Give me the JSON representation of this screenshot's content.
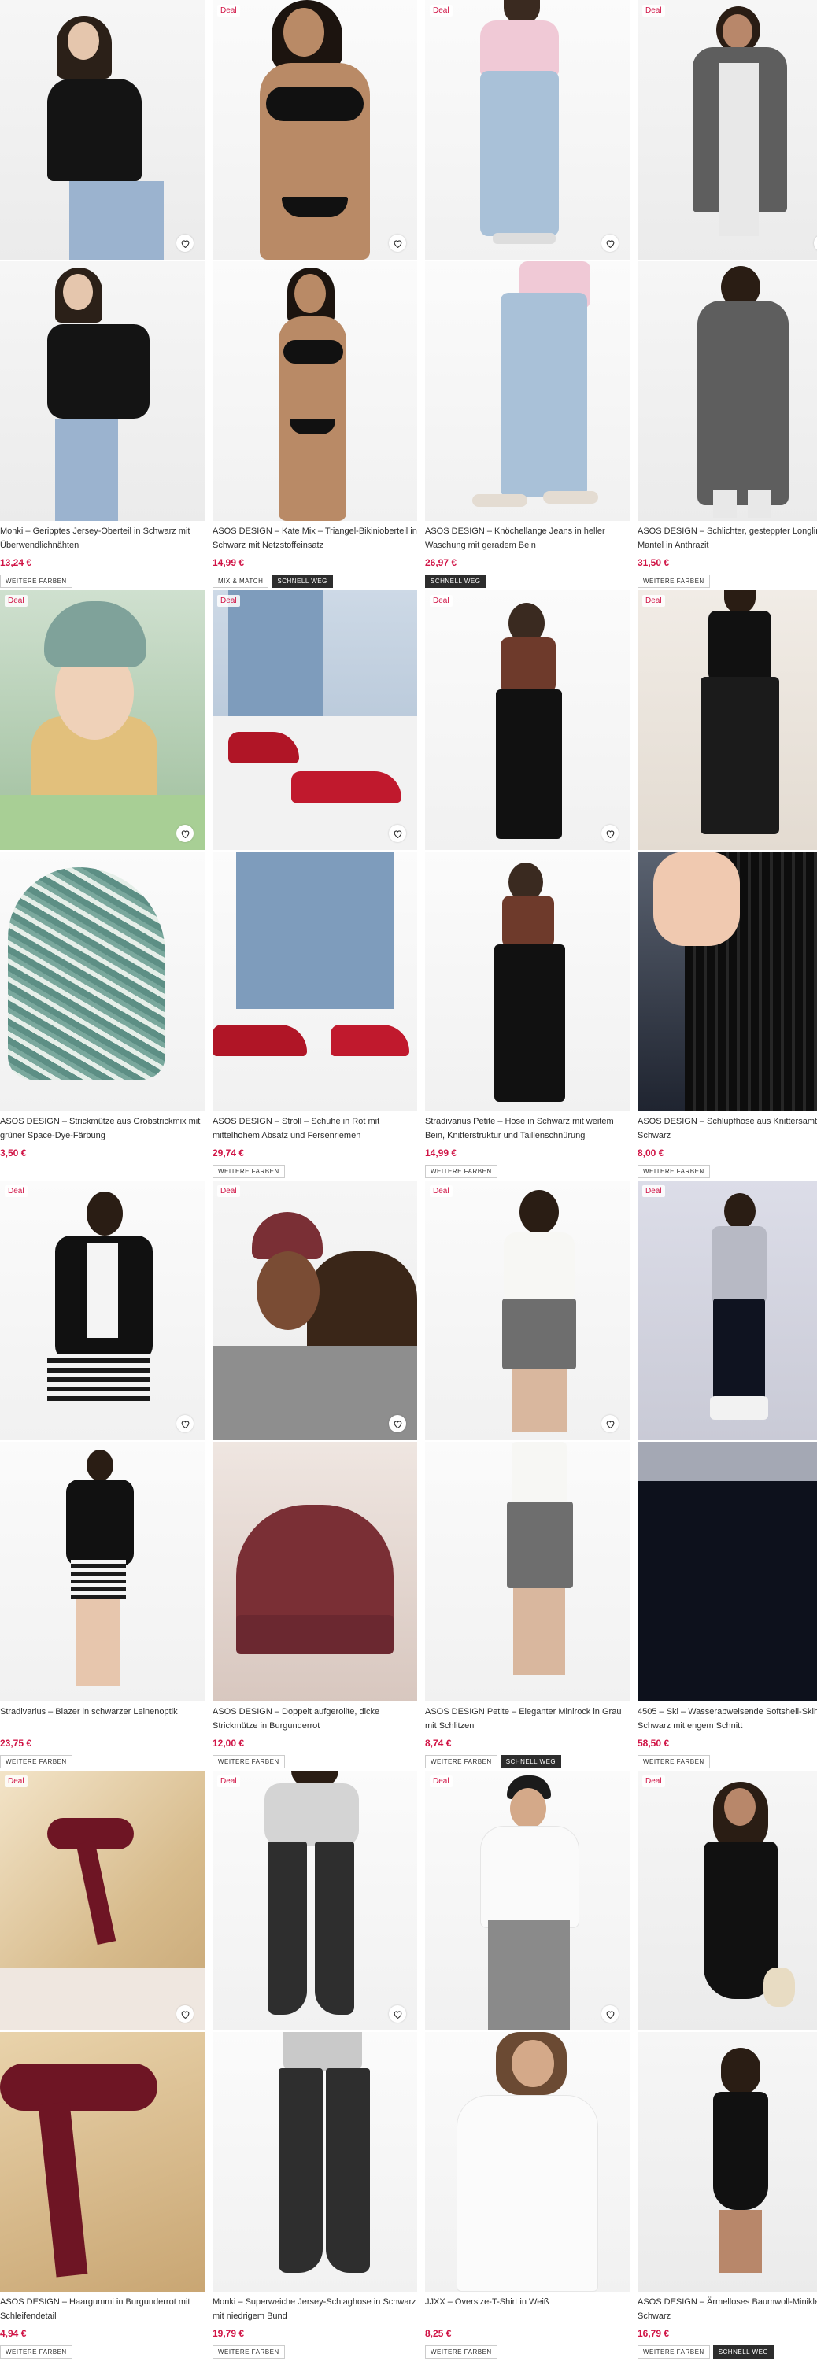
{
  "labels": {
    "deal": "Deal"
  },
  "products": [
    {
      "title": "Monki – Geripptes Jersey-Oberteil in Schwarz mit Überwendlichnähten",
      "price": "13,24 €",
      "deal": false,
      "tags": [
        {
          "label": "WEITERE FARBEN",
          "style": "outline"
        }
      ]
    },
    {
      "title": "ASOS DESIGN – Kate Mix – Triangel-Bikinioberteil in Schwarz mit Netzstoffeinsatz",
      "price": "14,99 €",
      "deal": true,
      "tags": [
        {
          "label": "MIX & MATCH",
          "style": "outline"
        },
        {
          "label": "SCHNELL WEG",
          "style": "dark"
        }
      ]
    },
    {
      "title": "ASOS DESIGN – Knöchellange Jeans in heller Waschung mit geradem Bein",
      "price": "26,97 €",
      "deal": true,
      "tags": [
        {
          "label": "SCHNELL WEG",
          "style": "dark"
        }
      ]
    },
    {
      "title": "ASOS DESIGN – Schlichter, gesteppter Longline-Mantel in Anthrazit",
      "price": "31,50 €",
      "deal": true,
      "tags": [
        {
          "label": "WEITERE FARBEN",
          "style": "outline"
        }
      ]
    },
    {
      "title": "ASOS DESIGN – Strickmütze aus Grobstrickmix mit grüner Space-Dye-Färbung",
      "price": "3,50 €",
      "deal": true,
      "tags": []
    },
    {
      "title": "ASOS DESIGN – Stroll – Schuhe in Rot mit mittelhohem Absatz und Fersenriemen",
      "price": "29,74 €",
      "deal": true,
      "tags": [
        {
          "label": "WEITERE FARBEN",
          "style": "outline"
        }
      ]
    },
    {
      "title": "Stradivarius Petite – Hose in Schwarz mit weitem Bein, Knitterstruktur und Taillenschnürung",
      "price": "14,99 €",
      "deal": true,
      "tags": [
        {
          "label": "WEITERE FARBEN",
          "style": "outline"
        }
      ]
    },
    {
      "title": "ASOS DESIGN – Schlupfhose aus Knittersamt in Schwarz",
      "price": "8,00 €",
      "deal": true,
      "tags": [
        {
          "label": "WEITERE FARBEN",
          "style": "outline"
        }
      ]
    },
    {
      "title": "Stradivarius – Blazer in schwarzer Leinenoptik",
      "price": "23,75 €",
      "deal": true,
      "tags": [
        {
          "label": "WEITERE FARBEN",
          "style": "outline"
        }
      ]
    },
    {
      "title": "ASOS DESIGN – Doppelt aufgerollte, dicke Strickmütze in Burgunderrot",
      "price": "12,00 €",
      "deal": true,
      "tags": [
        {
          "label": "WEITERE FARBEN",
          "style": "outline"
        }
      ]
    },
    {
      "title": "ASOS DESIGN Petite – Eleganter Minirock in Grau mit Schlitzen",
      "price": "8,74 €",
      "deal": true,
      "tags": [
        {
          "label": "WEITERE FARBEN",
          "style": "outline"
        },
        {
          "label": "SCHNELL WEG",
          "style": "dark"
        }
      ]
    },
    {
      "title": "4505 – Ski – Wasserabweisende Softshell-Skihose in Schwarz mit engem Schnitt",
      "price": "58,50 €",
      "deal": true,
      "tags": [
        {
          "label": "WEITERE FARBEN",
          "style": "outline"
        }
      ]
    },
    {
      "title": "ASOS DESIGN – Haargummi in Burgunderrot mit Schleifendetail",
      "price": "4,94 €",
      "deal": true,
      "tags": [
        {
          "label": "WEITERE FARBEN",
          "style": "outline"
        }
      ]
    },
    {
      "title": "Monki – Superweiche Jersey-Schlaghose in Schwarz mit niedrigem Bund",
      "price": "19,79 €",
      "deal": true,
      "tags": [
        {
          "label": "WEITERE FARBEN",
          "style": "outline"
        }
      ]
    },
    {
      "title": "JJXX – Oversize-T-Shirt in Weiß",
      "price": "8,25 €",
      "deal": true,
      "tags": [
        {
          "label": "WEITERE FARBEN",
          "style": "outline"
        }
      ]
    },
    {
      "title": "ASOS DESIGN – Ärmelloses Baumwoll-Minikleid in Schwarz",
      "price": "16,79 €",
      "deal": true,
      "tags": [
        {
          "label": "WEITERE FARBEN",
          "style": "outline"
        },
        {
          "label": "SCHNELL WEG",
          "style": "dark"
        }
      ]
    }
  ]
}
